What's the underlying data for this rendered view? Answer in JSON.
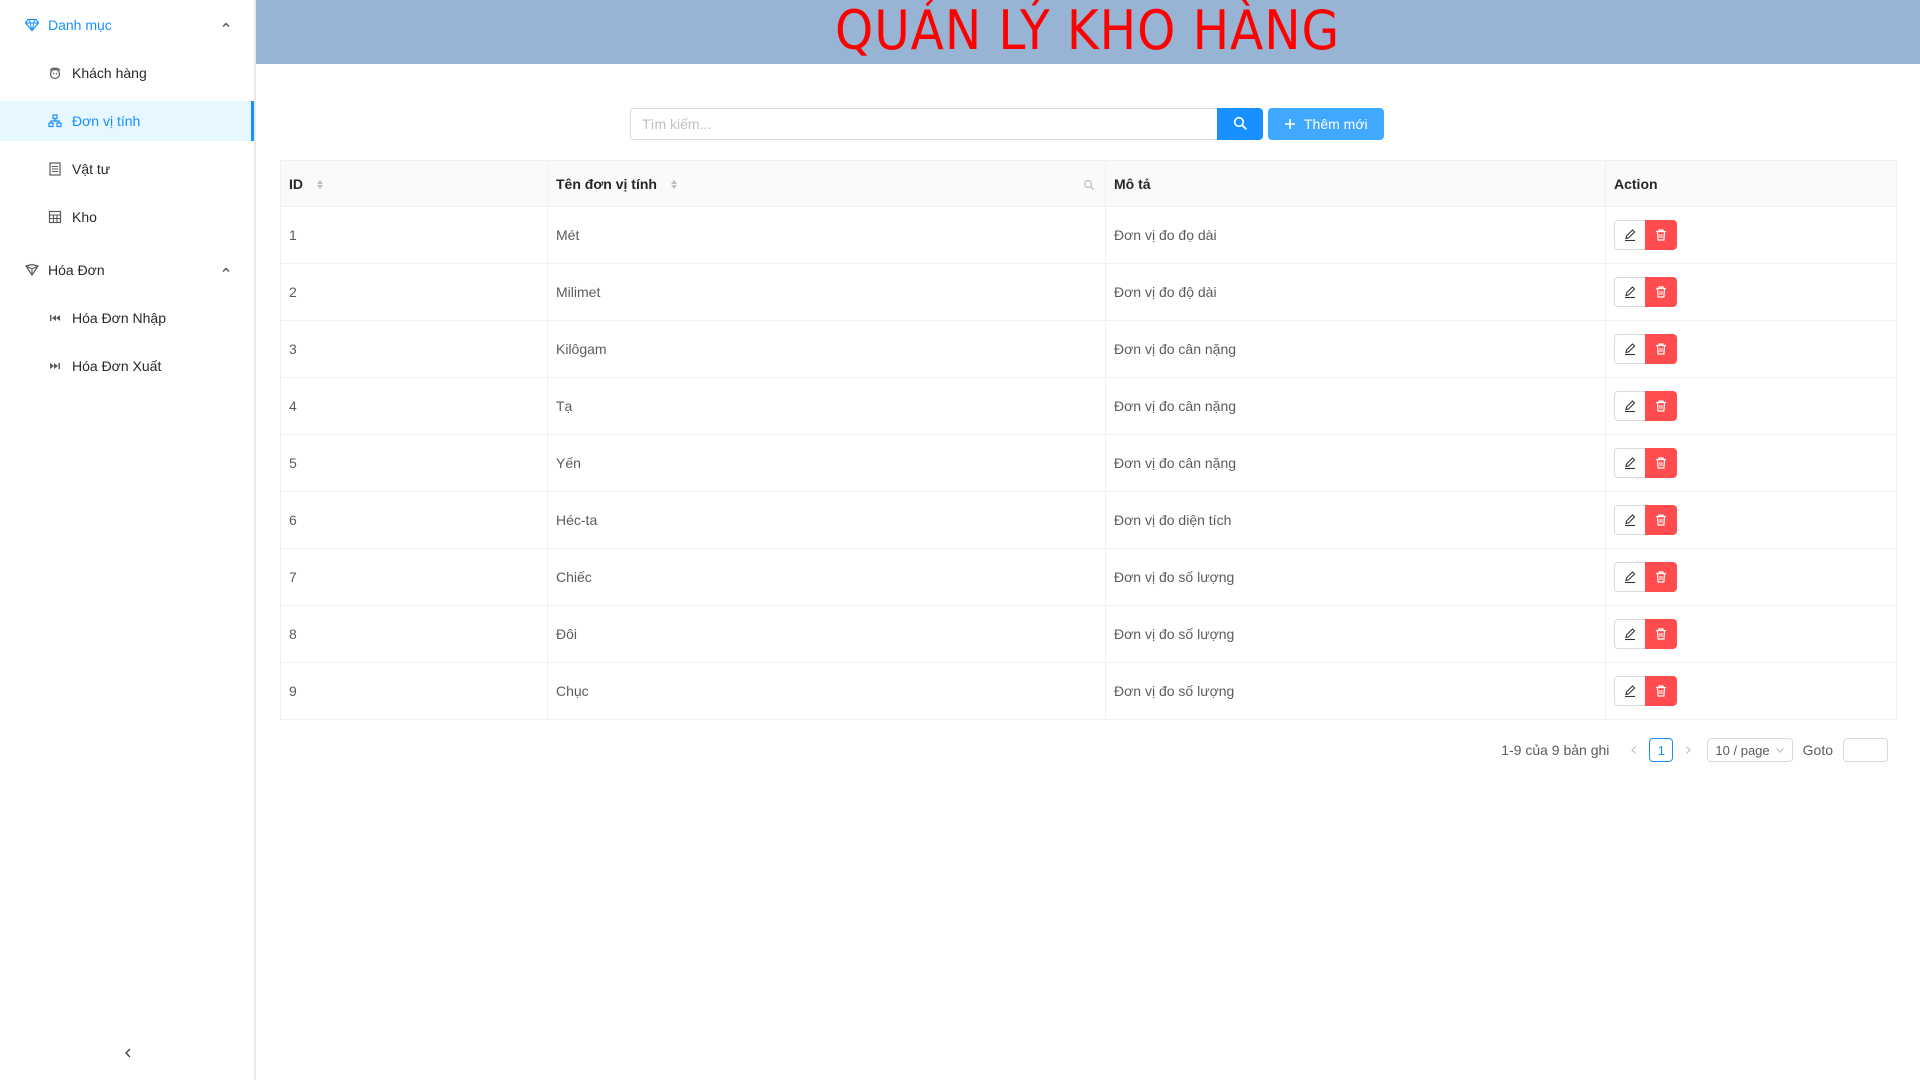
{
  "header": {
    "title": "QUẢN LÝ KHO HÀNG"
  },
  "sidebar": {
    "groups": [
      {
        "label": "Danh mục",
        "icon": "diamond-icon",
        "items": [
          {
            "label": "Khách hàng",
            "icon": "customer-icon"
          },
          {
            "label": "Đơn vị tính",
            "icon": "cluster-icon",
            "active": true
          },
          {
            "label": "Vật tư",
            "icon": "list-icon"
          },
          {
            "label": "Kho",
            "icon": "warehouse-icon"
          }
        ]
      },
      {
        "label": "Hóa Đơn",
        "icon": "money-icon",
        "items": [
          {
            "label": "Hóa Đơn Nhập",
            "icon": "step-backward-icon"
          },
          {
            "label": "Hóa Đơn Xuất",
            "icon": "step-forward-icon"
          }
        ]
      }
    ]
  },
  "toolbar": {
    "search_placeholder": "Tìm kiếm...",
    "search_value": "",
    "add_label": "Thêm mới"
  },
  "table": {
    "columns": [
      "ID",
      "Tên đơn vị tính",
      "Mô tả",
      "Action"
    ],
    "rows": [
      {
        "id": "1",
        "name": "Mét",
        "desc": "Đơn vị đo đọ dài"
      },
      {
        "id": "2",
        "name": "Milimet",
        "desc": "Đơn vị đo độ dài"
      },
      {
        "id": "3",
        "name": "Kilôgam",
        "desc": "Đơn vị đo cân nặng"
      },
      {
        "id": "4",
        "name": "Tạ",
        "desc": "Đơn vị đo cân nặng"
      },
      {
        "id": "5",
        "name": "Yến",
        "desc": "Đơn vị đo cân nặng"
      },
      {
        "id": "6",
        "name": "Héc-ta",
        "desc": "Đơn vị đo diện tích"
      },
      {
        "id": "7",
        "name": "Chiếc",
        "desc": "Đơn vị đo số lượng"
      },
      {
        "id": "8",
        "name": "Đôi",
        "desc": "Đơn vị đo số lượng"
      },
      {
        "id": "9",
        "name": "Chục",
        "desc": "Đơn vị đo số lượng"
      }
    ]
  },
  "pagination": {
    "total_text": "1-9 của 9 bản ghi",
    "current_page": "1",
    "page_size": "10 / page",
    "goto_label": "Goto",
    "goto_value": ""
  },
  "colors": {
    "header_bg": "#98b4d4",
    "title": "#ff0000",
    "primary": "#1890ff",
    "danger": "#ff4d4f"
  }
}
